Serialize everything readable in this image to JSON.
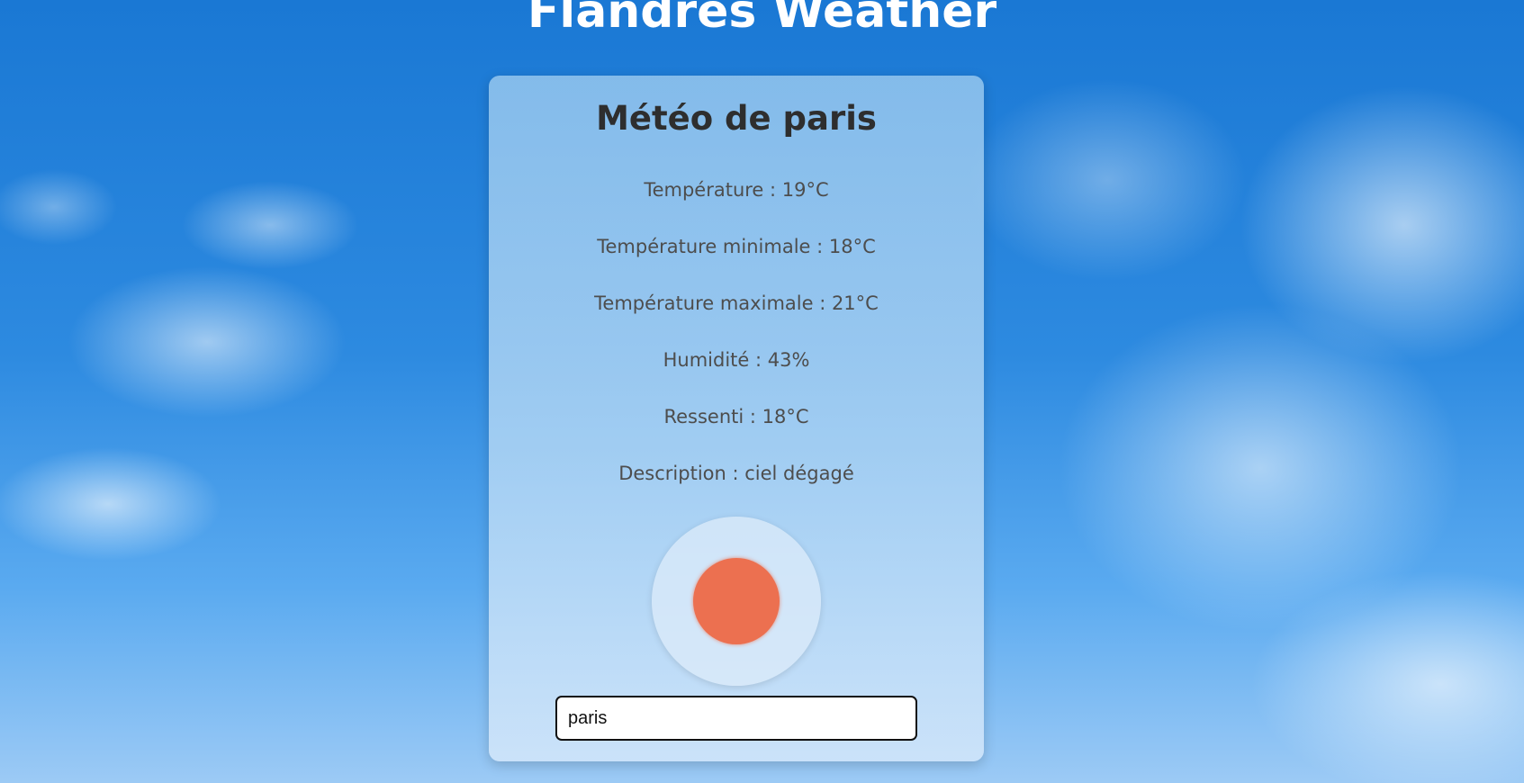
{
  "header": {
    "title": "Flandres Weather"
  },
  "weather": {
    "title": "Météo de paris",
    "temperature": "Température : 19°C",
    "temp_min": "Température minimale : 18°C",
    "temp_max": "Température maximale : 21°C",
    "humidity": "Humidité : 43%",
    "feels_like": "Ressenti : 18°C",
    "description": "Description : ciel dégagé",
    "icon": "sun-icon",
    "icon_color": "#ec7050"
  },
  "search": {
    "value": "paris",
    "placeholder": ""
  }
}
